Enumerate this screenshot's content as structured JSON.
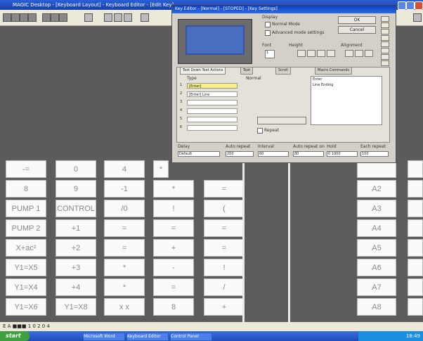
{
  "window": {
    "title": "MAGIC Desktop - [Keyboard Layout] - Keyboard Editor - [Edit Key]"
  },
  "dialog": {
    "title": "Key Editor - [Normal] - [STOPED] - [Key Settings]",
    "mode_label": "Display",
    "opt_normal": "Normal Mode",
    "opt_advanced": "Advanced mode settings",
    "ok": "OK",
    "cancel": "Cancel",
    "font_label": "Font",
    "size_label": "Height",
    "size_value": "1",
    "align_label": "Alignment",
    "tabs": [
      "Text Down Text Actions",
      "Text",
      "Scroll",
      "Macro Commands"
    ],
    "type_label": "Type",
    "type_value": "Normal",
    "rows": [
      {
        "num": "1",
        "value": "[Enter]"
      },
      {
        "num": "2",
        "value": "[Enter] Line"
      },
      {
        "num": "3",
        "value": ""
      },
      {
        "num": "4",
        "value": ""
      },
      {
        "num": "5",
        "value": ""
      },
      {
        "num": "6",
        "value": ""
      }
    ],
    "list_items": [
      "Enter",
      "Line Ending"
    ],
    "repeat_label": "Repeat",
    "bottom_labels": [
      "Delay",
      "Auto repeat",
      "Interval",
      "Auto repeat on",
      "Hold",
      "Each repeat"
    ],
    "bottom_values": [
      "Default",
      "200",
      "60",
      "80",
      "0 1000",
      "100"
    ]
  },
  "keys": {
    "row1": [
      "-=",
      "0",
      "4",
      "*"
    ],
    "row2": [
      "8",
      "9",
      "-1",
      "*",
      "="
    ],
    "row3": [
      "PUMP 1",
      "CONTROL",
      "/0",
      "!",
      "("
    ],
    "row4": [
      "PUMP 2",
      "+1",
      "=",
      "=",
      "="
    ],
    "row5": [
      "X+ac²",
      "+2",
      "=",
      "+",
      "="
    ],
    "row6": [
      "Y1=X5",
      "+3",
      "*",
      "-",
      "!"
    ],
    "row7": [
      "Y1=X4",
      "+4",
      "*",
      "=",
      "/"
    ],
    "row8": [
      "Y1=X6",
      "Y1=X8",
      "x x",
      "8",
      "+"
    ],
    "right_col": [
      "",
      "A2",
      "A3",
      "A4",
      "A5",
      "A6",
      "A7",
      "A8"
    ]
  },
  "status": {
    "text": "E A ■■■ 1 0 2 0 4"
  },
  "taskbar": {
    "start": "start",
    "tasks": [
      "Microsoft Word",
      "Keyboard Editor",
      "Control Panel"
    ],
    "clock": "18:49"
  }
}
